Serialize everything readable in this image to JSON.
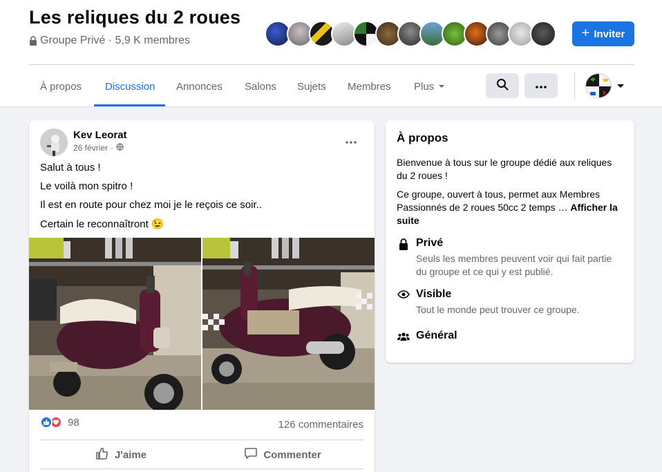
{
  "group": {
    "title": "Les reliques du 2 roues",
    "meta": "Groupe Privé · 5,9 K membres",
    "invite_label": "Inviter"
  },
  "colors": {
    "accent": "#1b74e4",
    "background": "#f0f2f5",
    "secondary_text": "#65676b",
    "love": "#f33e58"
  },
  "tabs": [
    {
      "label": "À propos",
      "active": false
    },
    {
      "label": "Discussion",
      "active": true
    },
    {
      "label": "Annonces",
      "active": false
    },
    {
      "label": "Salons",
      "active": false
    },
    {
      "label": "Sujets",
      "active": false
    },
    {
      "label": "Membres",
      "active": false
    },
    {
      "label": "Plus",
      "active": false
    }
  ],
  "icons": {
    "privacy": "lock-icon",
    "search": "search-icon",
    "more": "more-horizontal-icon",
    "dropdown": "caret-down-icon",
    "audience": "globe-icon",
    "like": "thumbs-up-icon",
    "comment": "comment-icon",
    "private": "lock-icon",
    "visible": "eye-icon",
    "general": "people-icon"
  },
  "post": {
    "author": "Kev Leorat",
    "date": "26 février",
    "lines": [
      "Salut à tous !",
      "Le voilà mon spitro !",
      "Il est en route pour chez moi je le reçois ce soir..",
      "Certain le reconnaîtront 😉"
    ],
    "reaction_count": "98",
    "comments_count": "126 commentaires",
    "like_label": "J'aime",
    "comment_label": "Commenter"
  },
  "about": {
    "title": "À propos",
    "intro": "Bienvenue à tous sur le groupe dédié aux reliques du 2 roues !",
    "description": "Ce groupe, ouvert à tous, permet aux Membres Passionnés de 2 roues 50cc 2 temps … ",
    "more_link": "Afficher la suite",
    "items": [
      {
        "title": "Privé",
        "desc": "Seuls les membres peuvent voir qui fait partie du groupe et ce qui y est publié."
      },
      {
        "title": "Visible",
        "desc": "Tout le monde peut trouver ce groupe."
      },
      {
        "title": "Général",
        "desc": ""
      }
    ]
  }
}
